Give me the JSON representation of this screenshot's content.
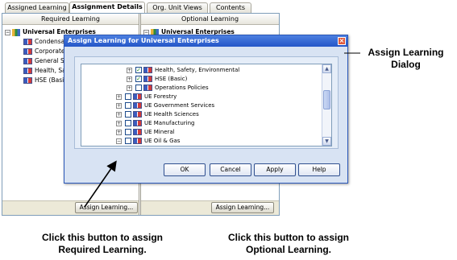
{
  "tabs": [
    {
      "label": "Assigned Learning",
      "active": false
    },
    {
      "label": "Assignment Details",
      "active": true
    },
    {
      "label": "Org. Unit Views",
      "active": false
    },
    {
      "label": "Contents",
      "active": false
    }
  ],
  "left_pane": {
    "header": "Required Learning",
    "root": "Universal Enterprises",
    "items": [
      "Condensat",
      "Corporate",
      "General S",
      "Health, Sa",
      "HSE (Basic"
    ],
    "button": "Assign Learning..."
  },
  "right_pane": {
    "header": "Optional Learning",
    "root": "Universal Enterprises",
    "button": "Assign Learning..."
  },
  "dialog": {
    "title": "Assign Learning for Universal Enterprises",
    "close_glyph": "×",
    "tree": [
      {
        "label": "Health, Safety, Environmental",
        "checked": true,
        "expander": "+",
        "indent": 2
      },
      {
        "label": "HSE (Basic)",
        "checked": true,
        "expander": "+",
        "indent": 2
      },
      {
        "label": "Operations Policies",
        "checked": false,
        "expander": "+",
        "indent": 2
      },
      {
        "label": "UE Forestry",
        "checked": false,
        "expander": "+",
        "indent": 1
      },
      {
        "label": "UE Government Services",
        "checked": false,
        "expander": "+",
        "indent": 1
      },
      {
        "label": "UE Health Sciences",
        "checked": false,
        "expander": "+",
        "indent": 1
      },
      {
        "label": "UE Manufacturing",
        "checked": false,
        "expander": "+",
        "indent": 1
      },
      {
        "label": "UE Mineral",
        "checked": false,
        "expander": "+",
        "indent": 1
      },
      {
        "label": "UE Oil & Gas",
        "checked": false,
        "expander": "−",
        "indent": 1
      }
    ],
    "buttons": {
      "ok": "OK",
      "cancel": "Cancel",
      "apply": "Apply",
      "help": "Help"
    }
  },
  "annotations": {
    "dialog_note": "Assign Learning\nDialog",
    "required_note": "Click this button to assign\nRequired Learning.",
    "optional_note": "Click this button to assign\nOptional Learning."
  },
  "icons": {
    "checkmark": "✓",
    "scroll_up": "▲",
    "scroll_down": "▼"
  },
  "colors": {
    "dialog_title": "#2456c8",
    "dialog_body": "#d8e3f3",
    "checkmark": "#1f8a1f"
  }
}
